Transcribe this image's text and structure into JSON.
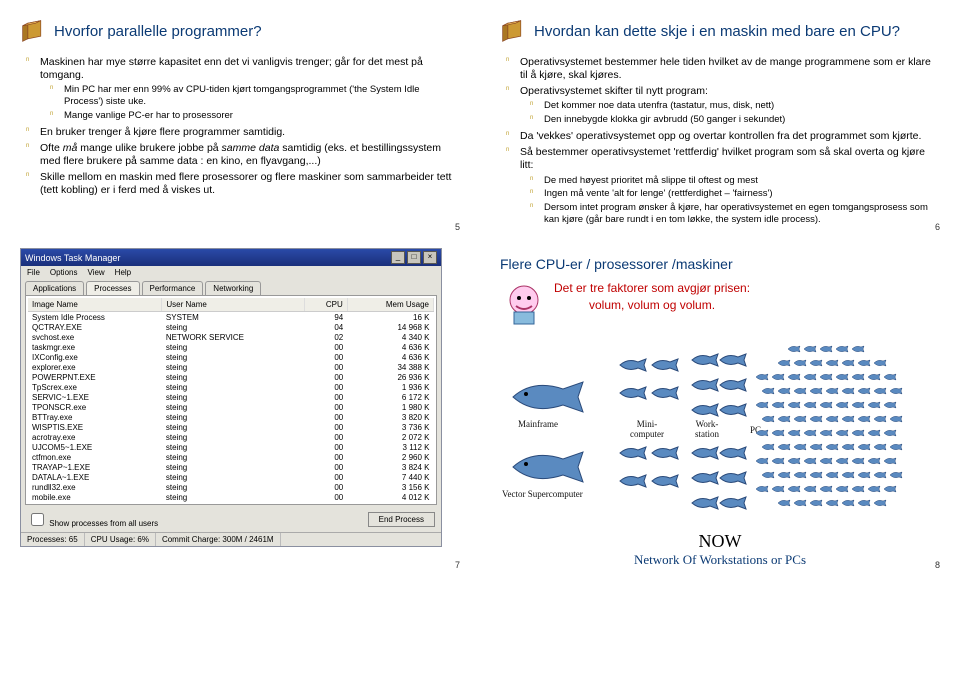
{
  "slide5": {
    "title": "Hvorfor parallelle programmer?",
    "items": [
      {
        "text": "Maskinen har mye større kapasitet enn det vi vanligvis trenger; går for det mest på tomgang.",
        "sub": [
          "Min PC har mer enn 99% av CPU-tiden kjørt tomgangsprogrammet ('the System Idle Process') siste uke.",
          "Mange vanlige PC-er har to prosessorer"
        ]
      },
      {
        "text": "En bruker trenger å kjøre flere programmer samtidig."
      },
      {
        "text_html": "Ofte <span class='em'>må</span> mange ulike brukere jobbe på <span class='em'>samme data</span> samtidig (eks. et bestillingssystem med flere brukere på samme data : en kino, en flyavgang,...)"
      },
      {
        "text": "Skille mellom en maskin med flere prosessorer og flere maskiner som sammarbeider tett (tett kobling) er i ferd med å viskes ut."
      }
    ],
    "pagenum": "5"
  },
  "slide6": {
    "title": "Hvordan kan dette skje i en maskin med bare en CPU?",
    "items": [
      {
        "text": "Operativsystemet bestemmer hele tiden hvilket av de mange programmene som er klare til å kjøre, skal kjøres."
      },
      {
        "text": "Operativsystemet skifter til nytt program:",
        "sub": [
          "Det kommer noe data utenfra (tastatur, mus, disk, nett)",
          "Den innebygde klokka gir avbrudd (50 ganger i sekundet)"
        ]
      },
      {
        "text": "Da 'vekkes' operativsystemet opp og overtar kontrollen fra det programmet som kjørte."
      },
      {
        "text": "Så bestemmer operativsystemet 'rettferdig' hvilket program som så skal overta og kjøre litt:",
        "sub": [
          "De med høyest prioritet må slippe til oftest og mest",
          "Ingen må vente 'alt for lenge' (rettferdighet – 'fairness')",
          "Dersom intet program ønsker å kjøre, har operativsystemet en egen tomgangsprosess som kan kjøre (går bare rundt i en tom løkke, the system idle process)."
        ]
      }
    ],
    "pagenum": "6"
  },
  "slide7": {
    "tm_title": "Windows Task Manager",
    "menu": [
      "File",
      "Options",
      "View",
      "Help"
    ],
    "tabs": [
      "Applications",
      "Processes",
      "Performance",
      "Networking"
    ],
    "columns": [
      "Image Name",
      "User Name",
      "CPU",
      "Mem Usage"
    ],
    "rows": [
      [
        "System Idle Process",
        "SYSTEM",
        "94",
        "16 K"
      ],
      [
        "QCTRAY.EXE",
        "steing",
        "04",
        "14 968 K"
      ],
      [
        "svchost.exe",
        "NETWORK SERVICE",
        "02",
        "4 340 K"
      ],
      [
        "taskmgr.exe",
        "steing",
        "00",
        "4 636 K"
      ],
      [
        "IXConfig.exe",
        "steing",
        "00",
        "4 636 K"
      ],
      [
        "explorer.exe",
        "steing",
        "00",
        "34 388 K"
      ],
      [
        "POWERPNT.EXE",
        "steing",
        "00",
        "26 936 K"
      ],
      [
        "TpScrex.exe",
        "steing",
        "00",
        "1 936 K"
      ],
      [
        "SERVIC~1.EXE",
        "steing",
        "00",
        "6 172 K"
      ],
      [
        "TPONSCR.exe",
        "steing",
        "00",
        "1 980 K"
      ],
      [
        "BTTray.exe",
        "steing",
        "00",
        "3 820 K"
      ],
      [
        "WISPTIS.EXE",
        "steing",
        "00",
        "3 736 K"
      ],
      [
        "acrotray.exe",
        "steing",
        "00",
        "2 072 K"
      ],
      [
        "UJCOM5~1.EXE",
        "steing",
        "00",
        "3 112 K"
      ],
      [
        "ctfmon.exe",
        "steing",
        "00",
        "2 960 K"
      ],
      [
        "TRAYAP~1.EXE",
        "steing",
        "00",
        "3 824 K"
      ],
      [
        "DATALA~1.EXE",
        "steing",
        "00",
        "7 440 K"
      ],
      [
        "rundll32.exe",
        "steing",
        "00",
        "3 156 K"
      ],
      [
        "mobile.exe",
        "steing",
        "00",
        "4 012 K"
      ]
    ],
    "show_all": "Show processes from all users",
    "end_btn": "End Process",
    "status": {
      "processes": "Processes: 65",
      "cpu": "CPU Usage: 6%",
      "commit": "Commit Charge: 300M / 2461M"
    },
    "pagenum": "7"
  },
  "slide8": {
    "title": "Flere CPU-er / prosessorer /maskiner",
    "red1": "Det er tre faktorer som avgjør prisen:",
    "red2": "volum, volum og volum.",
    "labels": {
      "mainframe": "Mainframe",
      "vector": "Vector Supercomputer",
      "mini": "Mini-\ncomputer",
      "work": "Work-\nstation",
      "pc": "PC"
    },
    "now": "NOW",
    "now_sub": "Network Of Workstations or PCs",
    "pagenum": "8"
  }
}
